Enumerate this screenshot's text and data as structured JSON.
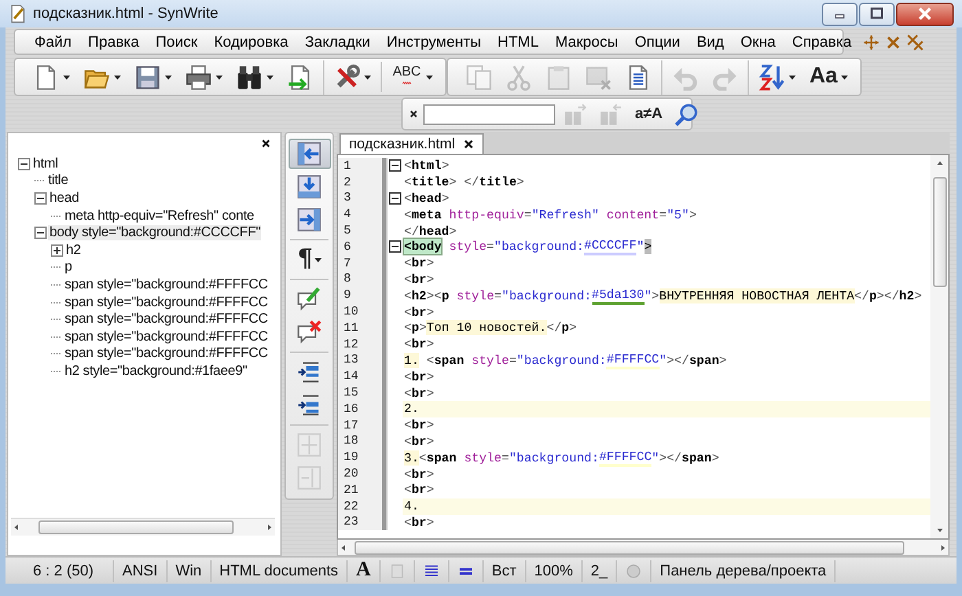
{
  "window": {
    "title": "подсказник.html - SynWrite"
  },
  "menu": {
    "items": [
      "Файл",
      "Правка",
      "Поиск",
      "Кодировка",
      "Закладки",
      "Инструменты",
      "HTML",
      "Макросы",
      "Опции",
      "Вид",
      "Окна",
      "Справка"
    ]
  },
  "toolbars": [
    {
      "groups": [
        [
          {
            "dropdown": true,
            "disabled": false
          },
          {
            "dropdown": true,
            "disabled": false
          },
          {
            "dropdown": true,
            "disabled": false
          },
          {
            "dropdown": true,
            "disabled": false
          },
          {
            "dropdown": true,
            "disabled": false
          },
          {
            "dropdown": false,
            "disabled": false
          }
        ],
        [
          {
            "dropdown": true,
            "disabled": false
          }
        ],
        [
          {
            "label": "ABC",
            "dropdown": true,
            "disabled": false
          }
        ]
      ]
    },
    {
      "groups": [
        [
          {
            "dropdown": false,
            "disabled": true
          },
          {
            "dropdown": false,
            "disabled": true
          },
          {
            "dropdown": false,
            "disabled": true
          },
          {
            "dropdown": false,
            "disabled": true
          },
          {
            "dropdown": false,
            "disabled": false
          }
        ],
        [
          {
            "dropdown": false,
            "disabled": true
          },
          {
            "dropdown": false,
            "disabled": true
          }
        ],
        [
          {
            "dropdown": true,
            "disabled": false
          },
          {
            "label": "Aa",
            "dropdown": true,
            "disabled": false
          }
        ]
      ]
    }
  ],
  "search_bar": {
    "buttons": [
      {
        "disabled": true
      },
      {
        "disabled": true
      },
      {
        "label": "a≠A",
        "disabled": false
      },
      {
        "disabled": false
      }
    ]
  },
  "tree": {
    "nodes": [
      {
        "label": "html",
        "expanded": true,
        "selected": false,
        "children": [
          {
            "label": "title",
            "selected": false
          },
          {
            "label": "head",
            "expanded": true,
            "selected": false,
            "children": [
              {
                "label": "meta http-equiv=\"Refresh\" conte",
                "selected": false
              }
            ]
          },
          {
            "label": "body style=\"background:#CCCCFF\"",
            "expanded": true,
            "selected": true,
            "children": [
              {
                "label": "h2",
                "expanded": false,
                "selected": false
              },
              {
                "label": "p",
                "selected": false
              },
              {
                "label": "span style=\"background:#FFFFCC",
                "selected": false
              },
              {
                "label": "span style=\"background:#FFFFCC",
                "selected": false
              },
              {
                "label": "span style=\"background:#FFFFCC",
                "selected": false
              },
              {
                "label": "span style=\"background:#FFFFCC",
                "selected": false
              },
              {
                "label": "span style=\"background:#FFFFCC",
                "selected": false
              },
              {
                "label": "h2 style=\"background:#1faee9\"",
                "selected": false
              }
            ]
          }
        ]
      }
    ]
  },
  "side_toolbar": {
    "buttons": [
      {
        "selected": true,
        "disabled": false
      },
      {
        "selected": false,
        "disabled": false
      },
      {
        "selected": false,
        "disabled": false
      },
      {
        "label": "¶",
        "dropdown": true,
        "selected": false,
        "disabled": false
      },
      {
        "selected": false,
        "disabled": false
      },
      {
        "selected": false,
        "disabled": false
      },
      {
        "selected": false,
        "disabled": false
      },
      {
        "selected": false,
        "disabled": false
      },
      {
        "selected": false,
        "disabled": true
      },
      {
        "selected": false,
        "disabled": true
      }
    ]
  },
  "editor": {
    "tabs": [
      {
        "label": "подсказник.html",
        "selected": true
      }
    ],
    "lines": [
      {
        "number": "1",
        "fold": true,
        "highlighted": false,
        "segments": [
          {
            "kind": "p",
            "text": "<"
          },
          {
            "kind": "tag",
            "text": "html"
          },
          {
            "kind": "p",
            "text": ">"
          }
        ]
      },
      {
        "number": "2",
        "fold": false,
        "highlighted": false,
        "segments": [
          {
            "kind": "p",
            "text": "<"
          },
          {
            "kind": "tag",
            "text": "title"
          },
          {
            "kind": "p",
            "text": "> </"
          },
          {
            "kind": "tag",
            "text": "title"
          },
          {
            "kind": "p",
            "text": ">"
          }
        ]
      },
      {
        "number": "3",
        "fold": true,
        "highlighted": false,
        "segments": [
          {
            "kind": "p",
            "text": "<"
          },
          {
            "kind": "tag",
            "text": "head"
          },
          {
            "kind": "p",
            "text": ">"
          }
        ]
      },
      {
        "number": "4",
        "fold": false,
        "highlighted": false,
        "segments": [
          {
            "kind": "p",
            "text": "<"
          },
          {
            "kind": "tag",
            "text": "meta"
          },
          {
            "kind": "attr",
            "text": " http-equiv"
          },
          {
            "kind": "p",
            "text": "="
          },
          {
            "kind": "str",
            "text": "\"Refresh\""
          },
          {
            "kind": "attr",
            "text": " content"
          },
          {
            "kind": "p",
            "text": "="
          },
          {
            "kind": "str",
            "text": "\"5\""
          },
          {
            "kind": "p",
            "text": ">"
          }
        ]
      },
      {
        "number": "5",
        "fold": false,
        "highlighted": false,
        "segments": [
          {
            "kind": "p",
            "text": "</"
          },
          {
            "kind": "tag",
            "text": "head"
          },
          {
            "kind": "p",
            "text": ">"
          }
        ]
      },
      {
        "number": "6",
        "fold": true,
        "highlighted": false,
        "segments": [
          {
            "kind": "match",
            "text": "<body"
          },
          {
            "kind": "attr",
            "text": " style"
          },
          {
            "kind": "p",
            "text": "="
          },
          {
            "kind": "str",
            "text": "\"background:"
          },
          {
            "kind": "hex",
            "text": "#CCCCFF"
          },
          {
            "kind": "str",
            "text": "\""
          },
          {
            "kind": "bracket",
            "text": ">"
          }
        ]
      },
      {
        "number": "7",
        "fold": false,
        "highlighted": false,
        "segments": [
          {
            "kind": "p",
            "text": "<"
          },
          {
            "kind": "tag",
            "text": "br"
          },
          {
            "kind": "p",
            "text": ">"
          }
        ]
      },
      {
        "number": "8",
        "fold": false,
        "highlighted": false,
        "segments": [
          {
            "kind": "p",
            "text": "<"
          },
          {
            "kind": "tag",
            "text": "br"
          },
          {
            "kind": "p",
            "text": ">"
          }
        ]
      },
      {
        "number": "9",
        "fold": false,
        "highlighted": false,
        "segments": [
          {
            "kind": "p",
            "text": "<"
          },
          {
            "kind": "tag",
            "text": "h2"
          },
          {
            "kind": "p",
            "text": "><"
          },
          {
            "kind": "tag",
            "text": "p"
          },
          {
            "kind": "attr",
            "text": " style"
          },
          {
            "kind": "p",
            "text": "="
          },
          {
            "kind": "str",
            "text": "\"background:"
          },
          {
            "kind": "hex",
            "text": "#5da130"
          },
          {
            "kind": "str",
            "text": "\""
          },
          {
            "kind": "p",
            "text": ">"
          },
          {
            "kind": "mark",
            "text": "ВНУТРЕННЯЯ НОВОСТНАЯ ЛЕНТА"
          },
          {
            "kind": "p",
            "text": "</"
          },
          {
            "kind": "tag",
            "text": "p"
          },
          {
            "kind": "p",
            "text": "></"
          },
          {
            "kind": "tag",
            "text": "h2"
          },
          {
            "kind": "p",
            "text": ">"
          }
        ]
      },
      {
        "number": "10",
        "fold": false,
        "highlighted": false,
        "segments": [
          {
            "kind": "p",
            "text": "<"
          },
          {
            "kind": "tag",
            "text": "br"
          },
          {
            "kind": "p",
            "text": ">"
          }
        ]
      },
      {
        "number": "11",
        "fold": false,
        "highlighted": false,
        "segments": [
          {
            "kind": "p",
            "text": "<"
          },
          {
            "kind": "tag",
            "text": "p"
          },
          {
            "kind": "p",
            "text": ">"
          },
          {
            "kind": "mark",
            "text": "Топ 10 новостей."
          },
          {
            "kind": "p",
            "text": "</"
          },
          {
            "kind": "tag",
            "text": "p"
          },
          {
            "kind": "p",
            "text": ">"
          }
        ]
      },
      {
        "number": "12",
        "fold": false,
        "highlighted": false,
        "segments": [
          {
            "kind": "p",
            "text": "<"
          },
          {
            "kind": "tag",
            "text": "br"
          },
          {
            "kind": "p",
            "text": ">"
          }
        ]
      },
      {
        "number": "13",
        "fold": false,
        "highlighted": false,
        "segments": [
          {
            "kind": "mark",
            "text": "1."
          },
          {
            "kind": "p",
            "text": " <"
          },
          {
            "kind": "tag",
            "text": "span"
          },
          {
            "kind": "attr",
            "text": " style"
          },
          {
            "kind": "p",
            "text": "="
          },
          {
            "kind": "str",
            "text": "\"background:"
          },
          {
            "kind": "hex",
            "text": "#FFFFCC"
          },
          {
            "kind": "str",
            "text": "\""
          },
          {
            "kind": "p",
            "text": "></"
          },
          {
            "kind": "tag",
            "text": "span"
          },
          {
            "kind": "p",
            "text": ">"
          }
        ]
      },
      {
        "number": "14",
        "fold": false,
        "highlighted": false,
        "segments": [
          {
            "kind": "p",
            "text": "<"
          },
          {
            "kind": "tag",
            "text": "br"
          },
          {
            "kind": "p",
            "text": ">"
          }
        ]
      },
      {
        "number": "15",
        "fold": false,
        "highlighted": false,
        "segments": [
          {
            "kind": "p",
            "text": "<"
          },
          {
            "kind": "tag",
            "text": "br"
          },
          {
            "kind": "p",
            "text": ">"
          }
        ]
      },
      {
        "number": "16",
        "fold": false,
        "highlighted": true,
        "segments": [
          {
            "kind": "txt",
            "text": "2."
          }
        ]
      },
      {
        "number": "17",
        "fold": false,
        "highlighted": false,
        "segments": [
          {
            "kind": "p",
            "text": "<"
          },
          {
            "kind": "tag",
            "text": "br"
          },
          {
            "kind": "p",
            "text": ">"
          }
        ]
      },
      {
        "number": "18",
        "fold": false,
        "highlighted": false,
        "segments": [
          {
            "kind": "p",
            "text": "<"
          },
          {
            "kind": "tag",
            "text": "br"
          },
          {
            "kind": "p",
            "text": ">"
          }
        ]
      },
      {
        "number": "19",
        "fold": false,
        "highlighted": false,
        "segments": [
          {
            "kind": "mark",
            "text": "3."
          },
          {
            "kind": "p",
            "text": "<"
          },
          {
            "kind": "tag",
            "text": "span"
          },
          {
            "kind": "attr",
            "text": " style"
          },
          {
            "kind": "p",
            "text": "="
          },
          {
            "kind": "str",
            "text": "\"background:"
          },
          {
            "kind": "hex",
            "text": "#FFFFCC"
          },
          {
            "kind": "str",
            "text": "\""
          },
          {
            "kind": "p",
            "text": "></"
          },
          {
            "kind": "tag",
            "text": "span"
          },
          {
            "kind": "p",
            "text": ">"
          }
        ]
      },
      {
        "number": "20",
        "fold": false,
        "highlighted": false,
        "segments": [
          {
            "kind": "p",
            "text": "<"
          },
          {
            "kind": "tag",
            "text": "br"
          },
          {
            "kind": "p",
            "text": ">"
          }
        ]
      },
      {
        "number": "21",
        "fold": false,
        "highlighted": false,
        "segments": [
          {
            "kind": "p",
            "text": "<"
          },
          {
            "kind": "tag",
            "text": "br"
          },
          {
            "kind": "p",
            "text": ">"
          }
        ]
      },
      {
        "number": "22",
        "fold": false,
        "highlighted": true,
        "segments": [
          {
            "kind": "txt",
            "text": "4."
          }
        ]
      },
      {
        "number": "23",
        "fold": false,
        "highlighted": false,
        "segments": [
          {
            "kind": "p",
            "text": "<"
          },
          {
            "kind": "tag",
            "text": "br"
          },
          {
            "kind": "p",
            "text": ">"
          }
        ]
      }
    ]
  },
  "status_bar": {
    "items": [
      {
        "kind": "text",
        "text": "6 : 2 (50)"
      },
      {
        "kind": "text",
        "text": "ANSI"
      },
      {
        "kind": "text",
        "text": "Win"
      },
      {
        "kind": "text",
        "text": "HTML documents"
      },
      {
        "kind": "glyph",
        "text": "A"
      },
      {
        "kind": "icon"
      },
      {
        "kind": "icon"
      },
      {
        "kind": "icon"
      },
      {
        "kind": "text",
        "text": "Вст"
      },
      {
        "kind": "text",
        "text": "100%"
      },
      {
        "kind": "text",
        "text": "2_"
      },
      {
        "kind": "icon"
      },
      {
        "kind": "text",
        "text": "Панель дерева/проекта"
      }
    ]
  }
}
